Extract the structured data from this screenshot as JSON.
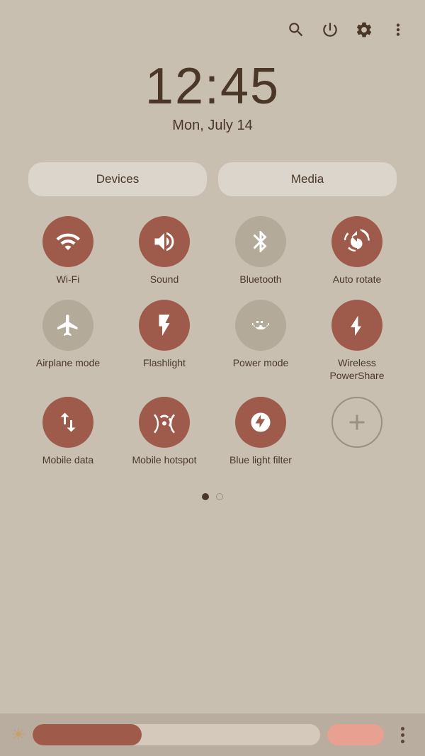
{
  "header": {
    "time": "12:45",
    "date": "Mon, July 14"
  },
  "nav_buttons": {
    "devices_label": "Devices",
    "media_label": "Media"
  },
  "tiles": [
    {
      "id": "wifi",
      "label": "Wi-Fi",
      "active": true
    },
    {
      "id": "sound",
      "label": "Sound",
      "active": true
    },
    {
      "id": "bluetooth",
      "label": "Bluetooth",
      "active": false
    },
    {
      "id": "autorotate",
      "label": "Auto rotate",
      "active": true
    },
    {
      "id": "airplane",
      "label": "Airplane mode",
      "active": false
    },
    {
      "id": "flashlight",
      "label": "Flashlight",
      "active": true
    },
    {
      "id": "powermode",
      "label": "Power mode",
      "active": false
    },
    {
      "id": "wireless",
      "label": "Wireless PowerShare",
      "active": true
    },
    {
      "id": "mobiledata",
      "label": "Mobile data",
      "active": true
    },
    {
      "id": "mobilehotspot",
      "label": "Mobile hotspot",
      "active": true
    },
    {
      "id": "bluelightfilter",
      "label": "Blue light filter",
      "active": true
    },
    {
      "id": "add",
      "label": "",
      "active": false,
      "isAdd": true
    }
  ],
  "pagination": {
    "current": 0,
    "total": 2
  },
  "brightness": {
    "level": 38
  }
}
